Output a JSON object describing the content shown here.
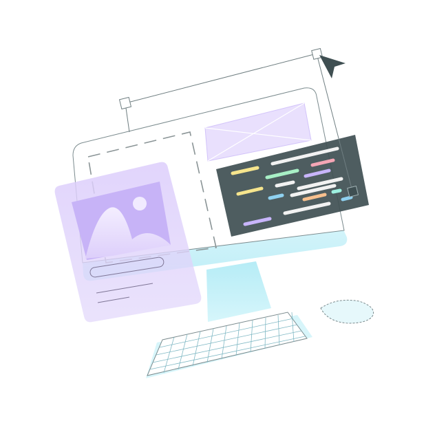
{
  "illustration": {
    "subject": "desktop-computer-web-design",
    "colors": {
      "outline": "#7a8a8d",
      "screen_fill": "#ffffff",
      "monitor_chin": "#c9f1f8",
      "stand": "#bfeff8",
      "keyboard_base": "#d7f5fa",
      "card_fill": "#dccdfb",
      "image_frame": "#c7b3f7",
      "mountain": "#efe8ff",
      "sun": "#f1ebff",
      "wireframe_box": "#e9e0fd",
      "code_panel": "#3f4f52",
      "cursor": "#3f4f52",
      "code_yellow": "#f6e58d",
      "code_white": "#f2f2f2",
      "code_pink": "#f4a6b5",
      "code_green": "#a8f0c6",
      "code_purple": "#c8b5fb",
      "code_blue": "#8fd1f0",
      "code_orange": "#f7c08e",
      "code_teal": "#9df0e0"
    },
    "icons": [
      "image-placeholder-icon",
      "arrow-cursor-icon",
      "selection-handle-icon"
    ]
  }
}
